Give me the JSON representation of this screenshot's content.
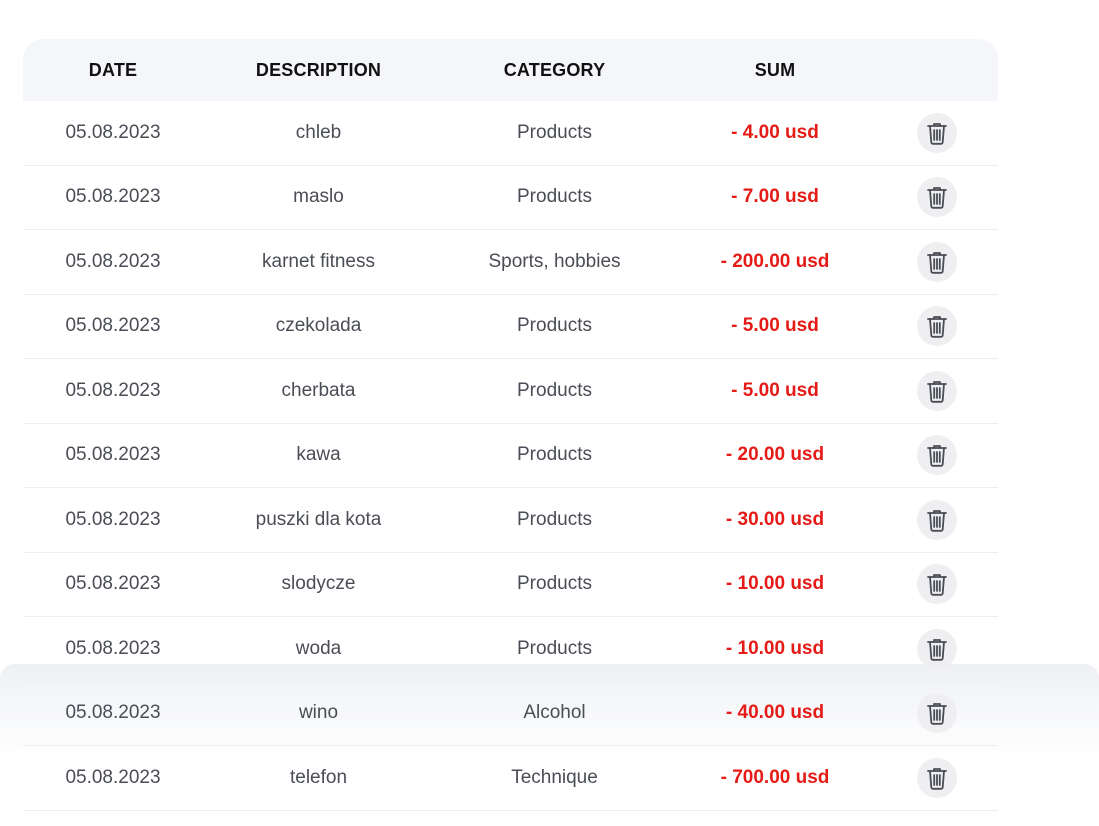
{
  "table": {
    "headers": {
      "date": "DATE",
      "description": "DESCRIPTION",
      "category": "CATEGORY",
      "sum": "SUM"
    },
    "rows": [
      {
        "date": "05.08.2023",
        "description": "chleb",
        "category": "Products",
        "sum": "- 4.00 usd"
      },
      {
        "date": "05.08.2023",
        "description": "maslo",
        "category": "Products",
        "sum": "- 7.00 usd"
      },
      {
        "date": "05.08.2023",
        "description": "karnet fitness",
        "category": "Sports, hobbies",
        "sum": "- 200.00 usd"
      },
      {
        "date": "05.08.2023",
        "description": "czekolada",
        "category": "Products",
        "sum": "- 5.00 usd"
      },
      {
        "date": "05.08.2023",
        "description": "cherbata",
        "category": "Products",
        "sum": "- 5.00 usd"
      },
      {
        "date": "05.08.2023",
        "description": "kawa",
        "category": "Products",
        "sum": "- 20.00 usd"
      },
      {
        "date": "05.08.2023",
        "description": "puszki dla kota",
        "category": "Products",
        "sum": "- 30.00 usd"
      },
      {
        "date": "05.08.2023",
        "description": "slodycze",
        "category": "Products",
        "sum": "- 10.00 usd"
      },
      {
        "date": "05.08.2023",
        "description": "woda",
        "category": "Products",
        "sum": "- 10.00 usd"
      },
      {
        "date": "05.08.2023",
        "description": "wino",
        "category": "Alcohol",
        "sum": "- 40.00 usd"
      },
      {
        "date": "05.08.2023",
        "description": "telefon",
        "category": "Technique",
        "sum": "- 700.00 usd"
      }
    ],
    "row_action_icon": "trash-icon"
  },
  "colors": {
    "expense_sum": "#e41b17",
    "header_bg": "#f5f6fa",
    "text": "#4a4d55",
    "icon_bg": "#efeff1"
  }
}
